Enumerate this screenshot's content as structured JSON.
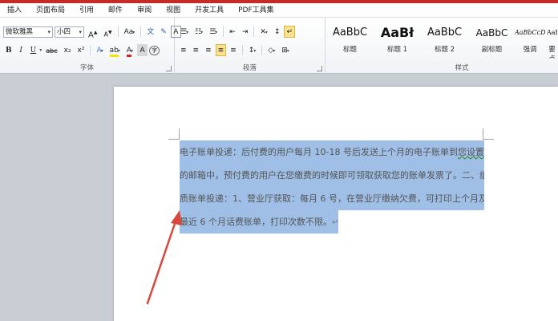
{
  "tabs": [
    "插入",
    "页面布局",
    "引用",
    "邮件",
    "审阅",
    "视图",
    "开发工具",
    "PDF工具集"
  ],
  "font_group": {
    "font_name": "微软雅黑",
    "font_size": "小四",
    "grow_font": "A",
    "shrink_font": "A",
    "change_case": "Aa",
    "phonetic_guide": "文",
    "char_border": "A",
    "bold": "B",
    "italic": "I",
    "underline": "U",
    "strikethrough": "abc",
    "subscript": "x₂",
    "superscript": "x²",
    "text_effects": "A",
    "font_color": "A",
    "char_shading": "A",
    "enclosed_char": "字",
    "label": "字体"
  },
  "paragraph_group": {
    "bullets": "☰",
    "numbering": "☷",
    "multilevel": "☰",
    "decrease_indent": "⇤",
    "increase_indent": "⇥",
    "chinese_layout": "✕",
    "sort": "↕",
    "show_marks": "↵",
    "align_left": "≡",
    "center": "≡",
    "align_right": "≡",
    "justify": "≡",
    "distributed": "≡",
    "line_spacing": "↕",
    "shading": "◇",
    "borders": "⊞",
    "label": "段落"
  },
  "styles_group": {
    "items": [
      {
        "sample": "AaBbC",
        "name": "标题"
      },
      {
        "sample": "AaBł",
        "name": "标题 1"
      },
      {
        "sample": "AaBbC",
        "name": "标题 2"
      },
      {
        "sample": "AaBbC",
        "name": "副标题"
      },
      {
        "sample": "AaBbCcDi",
        "name": "强调"
      },
      {
        "sample": "AaBbCcDi",
        "name": "要点"
      }
    ],
    "label": "样式"
  },
  "document": {
    "line1_a": "电子账单投递：后付费的用户每月  10-18  号后发送上个月的电子账单到",
    "line1_b": "您设置",
    "line2": "的邮箱中，预付费的用户在您缴费的时候即可领取获取您的账单发票了。二、纸",
    "line3": "质账单投递：1、营业厅获取：每月 6 号，在营业厅缴纳欠费，可打印上个月及",
    "line4": "最近 6 个月话费账单，打印次数不限。",
    "paragraph_mark": "↵"
  },
  "colors": {
    "selection": "#9fbfe6",
    "arrow": "#d9463b",
    "brand_strip": "#c62b27"
  }
}
